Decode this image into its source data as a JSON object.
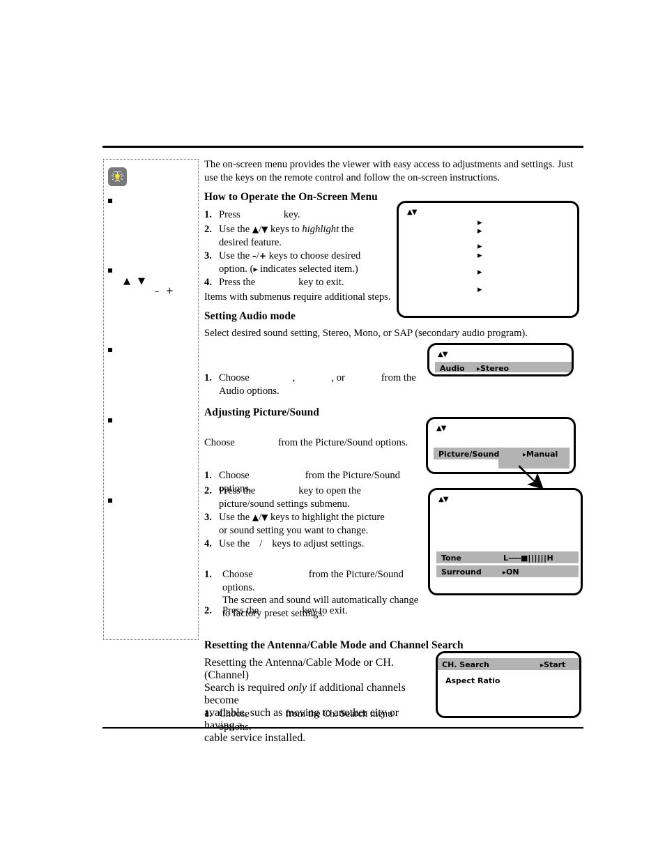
{
  "document": {
    "rules": {
      "top": true,
      "bottom": true
    }
  },
  "sidebar": {
    "tip_icon": "lightbulb-icon",
    "bullets": [
      "",
      "",
      "",
      "",
      ""
    ],
    "symbols": {
      "up": "▲",
      "down": "▼",
      "minus": "–",
      "plus": "+"
    }
  },
  "intro": {
    "paragraph": "The on-screen menu provides the viewer with easy access to adjustments and settings. Just use the keys on the remote control and follow the on-screen instructions."
  },
  "section_operate": {
    "heading": "How to Operate the On-Screen Menu",
    "steps": [
      {
        "num": "1.",
        "pre": "Press",
        "post": "key."
      },
      {
        "num": "2.",
        "line1_a": "Use the ",
        "sym_up": "▲",
        "slash": "/",
        "sym_down": "▼",
        "line1_b": " keys to ",
        "italic": "highlight",
        "line1_c": " the",
        "line2": "desired feature."
      },
      {
        "num": "3.",
        "line1_a": "Use the ",
        "minus": "–",
        "slash": "/",
        "plus": "+",
        "line1_b": " keys to choose desired",
        "line2_a": "option. (",
        "pointer": "▸",
        "line2_b": " indicates selected item.)"
      },
      {
        "num": "4.",
        "pre": "Press the",
        "post": "key to exit."
      }
    ],
    "note": "Items with submenus require additional steps."
  },
  "section_audio": {
    "heading": "Setting Audio mode",
    "paragraph": "Select desired sound setting, Stereo, Mono, or SAP (secondary audio program).",
    "step": {
      "num": "1.",
      "pre": "Choose",
      "mid1": ",",
      "mid2": ", or",
      "post": "from the Audio options."
    }
  },
  "section_picture": {
    "heading": "Adjusting Picture/Sound",
    "choose_line": {
      "pre": "Choose",
      "post": "from the Picture/Sound options."
    },
    "steps": [
      {
        "num": "1.",
        "pre": "Choose",
        "post": "from the Picture/Sound options."
      },
      {
        "num": "2.",
        "pre": "Press the",
        "post": "key to open the",
        "line2": "picture/sound settings submenu."
      },
      {
        "num": "3.",
        "line1_a": "Use the ",
        "sym_up": "▲",
        "slash": "/",
        "sym_down": "▼",
        "line1_b": " keys to highlight the picture",
        "line2": "or sound setting you want to change."
      },
      {
        "num": "4.",
        "line1_a": "Use the",
        "slash": "/",
        "line1_b": "keys to adjust settings."
      }
    ],
    "reset_steps": [
      {
        "num": "1.",
        "pre": "Choose",
        "post": "from the Picture/Sound options.",
        "line2": "The screen and sound will automatically change",
        "line3": "to factory preset settings."
      },
      {
        "num": "2.",
        "pre": "Press the",
        "post": "key to exit."
      }
    ]
  },
  "section_channel": {
    "heading": "Resetting the Antenna/Cable Mode and Channel Search",
    "paragraph_a": "Resetting the Antenna/Cable Mode or CH. (Channel)",
    "paragraph_b1": "Search is required ",
    "paragraph_b_italic": "only",
    "paragraph_b2": " if additional channels become",
    "paragraph_c": "available, such as moving to another city or having a",
    "paragraph_d": "cable service installed.",
    "step": {
      "num": "1.",
      "pre": "Choose",
      "post": "from the Ch. Search menu options."
    }
  },
  "tv_screens": {
    "main_menu": {
      "name": "main-menu-screen",
      "arrows": "▲▼",
      "pointers": [
        "▸",
        "▸",
        "▸",
        "▸",
        "▸",
        "▸"
      ]
    },
    "audio_menu": {
      "name": "audio-menu-screen",
      "arrows": "▲▼",
      "rows": [
        {
          "label": "Audio",
          "pointer": "▸",
          "value": "Stereo",
          "highlighted": true
        }
      ]
    },
    "picture_menu": {
      "name": "picture-sound-menu-screen",
      "arrows": "▲▼",
      "rows": [
        {
          "label": "Picture/Sound",
          "pointer": "▸",
          "value": "Manual",
          "highlighted": true
        }
      ]
    },
    "submenu": {
      "name": "picture-sound-submenu-screen",
      "arrows": "▲▼",
      "rows": [
        {
          "label": "Tone",
          "value_left": "L",
          "dashes": "––––",
          "marker": "■",
          "bars": "||||||",
          "value_right": "H",
          "highlighted": true
        },
        {
          "label": "Surround",
          "pointer": "▸",
          "value": "ON",
          "highlighted": true
        }
      ]
    },
    "ch_search": {
      "name": "ch-search-menu-screen",
      "rows": [
        {
          "label": "CH. Search",
          "pointer": "▸",
          "value": "Start",
          "highlighted": true
        },
        {
          "label": "Aspect Ratio",
          "highlighted": false
        }
      ]
    }
  },
  "colors": {
    "osd_highlight": "#b3b3b3",
    "tip_icon_bg": "#787878",
    "bulb": "#f5e432",
    "ink": "#000000"
  }
}
